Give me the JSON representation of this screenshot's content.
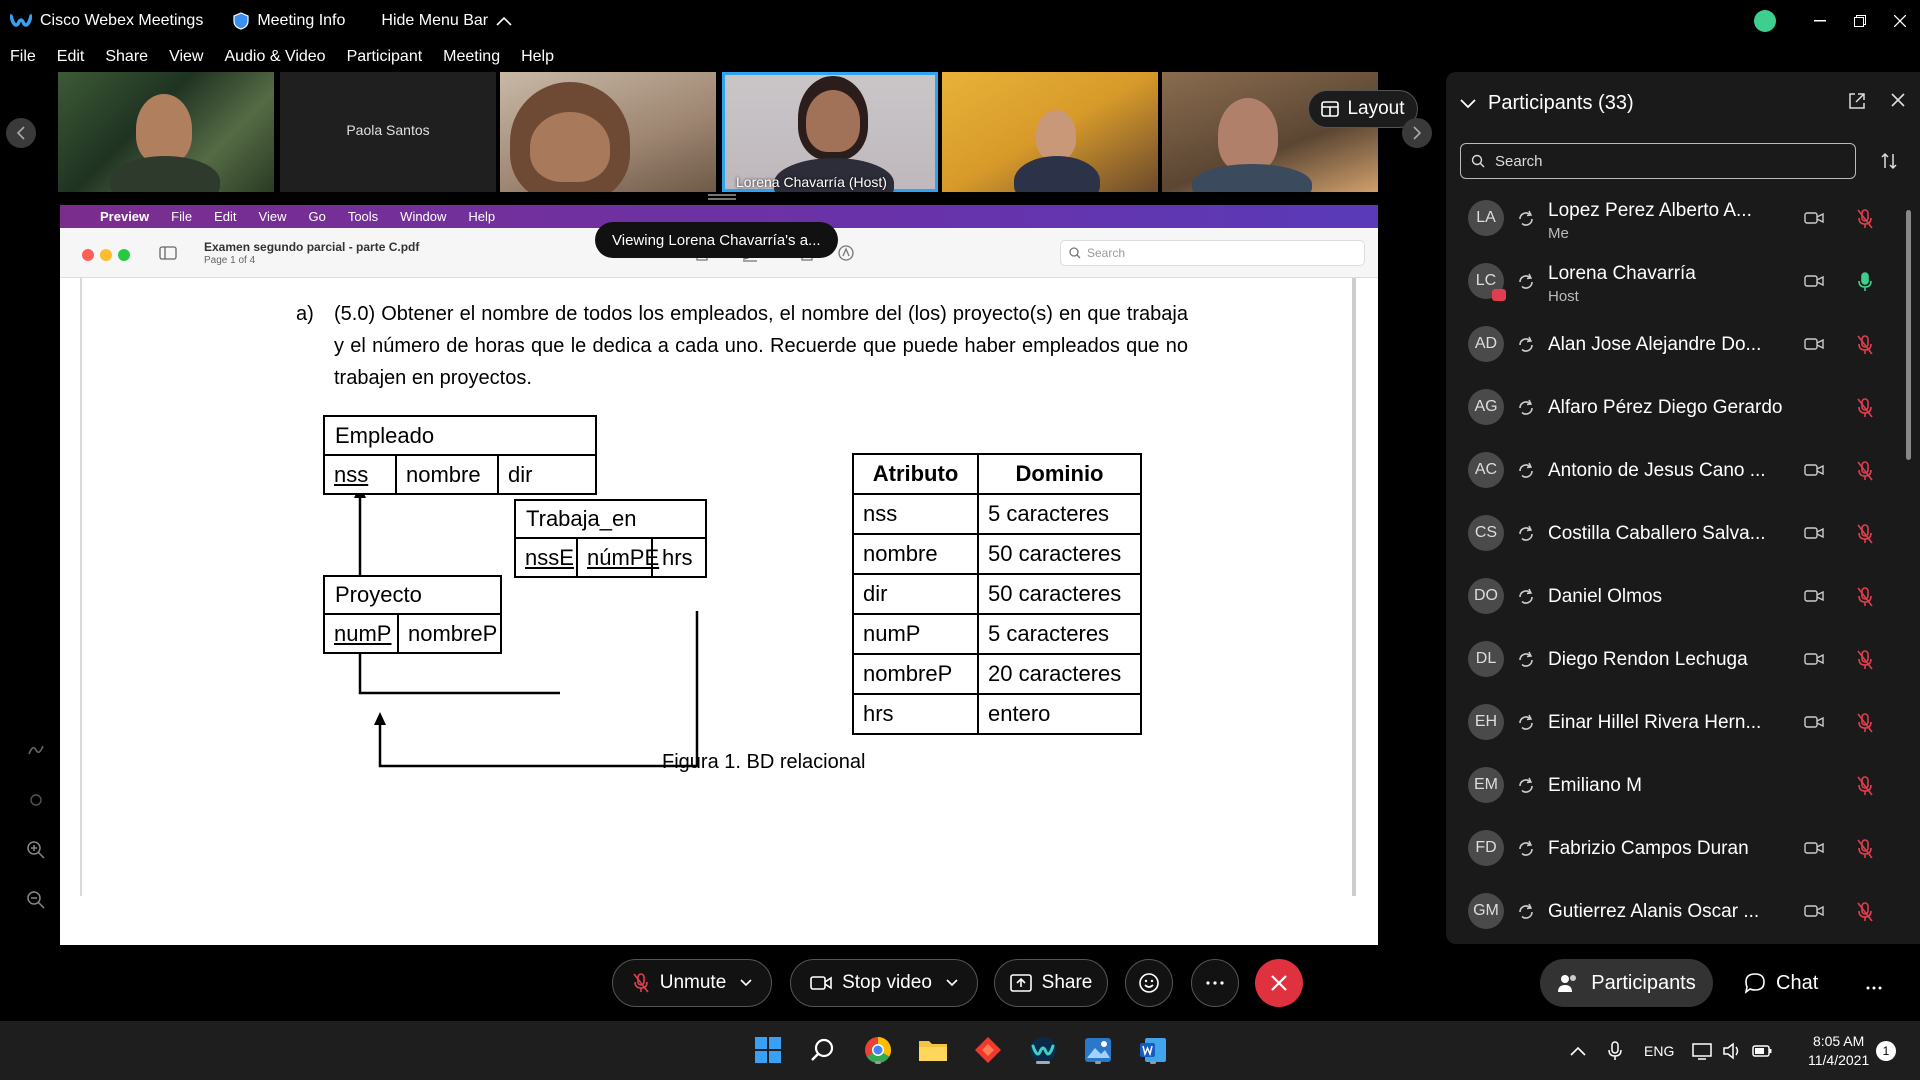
{
  "titlebar": {
    "app_title": "Cisco Webex Meetings",
    "meeting_info": "Meeting Info",
    "hide_menu_bar": "Hide Menu Bar"
  },
  "menu": [
    "File",
    "Edit",
    "Share",
    "View",
    "Audio & Video",
    "Participant",
    "Meeting",
    "Help"
  ],
  "video_strip": {
    "tiles": [
      {
        "name": ""
      },
      {
        "name": "Paola Santos"
      },
      {
        "name": ""
      },
      {
        "name": "Lorena Chavarría  (Host)"
      },
      {
        "name": ""
      },
      {
        "name": ""
      }
    ],
    "layout_label": "Layout"
  },
  "shared": {
    "mac_menu": [
      "Preview",
      "File",
      "Edit",
      "View",
      "Go",
      "Tools",
      "Window",
      "Help"
    ],
    "doc_title": "Examen segundo parcial - parte  C.pdf",
    "doc_sub": "Page 1 of 4",
    "search_placeholder": "Search",
    "viewing_tip": "Viewing Lorena Chavarría's a...",
    "question_num": "a)",
    "question": "(5.0) Obtener el nombre de todos los empleados, el nombre del (los) proyecto(s) en que trabaja y el número de horas que le dedica a cada uno. Recuerde que puede haber empleados que no trabajen en proyectos.",
    "empleado": {
      "title": "Empleado",
      "attrs": [
        "nss",
        "nombre",
        "dir"
      ]
    },
    "trabaja": {
      "title": "Trabaja_en",
      "attrs": [
        "nssE",
        "númPE",
        "hrs"
      ]
    },
    "proyecto": {
      "title": "Proyecto",
      "attrs": [
        "numP",
        "nombreP"
      ]
    },
    "domain_table": {
      "headers": [
        "Atributo",
        "Dominio"
      ],
      "rows": [
        [
          "nss",
          "5 caracteres"
        ],
        [
          "nombre",
          "50 caracteres"
        ],
        [
          "dir",
          "50 caracteres"
        ],
        [
          "numP",
          "5 caracteres"
        ],
        [
          "nombreP",
          "20 caracteres"
        ],
        [
          "hrs",
          "entero"
        ]
      ]
    },
    "caption": "Figura 1. BD relacional"
  },
  "panel": {
    "title": "Participants (33)",
    "search_placeholder": "Search",
    "participants": [
      {
        "initials": "LA",
        "name": "Lopez Perez Alberto A...",
        "role": "Me",
        "cam": true,
        "mic": "muted"
      },
      {
        "initials": "LC",
        "name": "Lorena Chavarría",
        "role": "Host",
        "cam": true,
        "mic": "active"
      },
      {
        "initials": "AD",
        "name": "Alan Jose Alejandre Do...",
        "role": "",
        "cam": true,
        "mic": "muted"
      },
      {
        "initials": "AG",
        "name": "Alfaro Pérez Diego Gerardo",
        "role": "",
        "cam": false,
        "mic": "muted"
      },
      {
        "initials": "AC",
        "name": "Antonio de Jesus Cano ...",
        "role": "",
        "cam": true,
        "mic": "muted"
      },
      {
        "initials": "CS",
        "name": "Costilla Caballero Salva...",
        "role": "",
        "cam": true,
        "mic": "muted"
      },
      {
        "initials": "DO",
        "name": "Daniel Olmos",
        "role": "",
        "cam": true,
        "mic": "muted"
      },
      {
        "initials": "DL",
        "name": "Diego Rendon Lechuga",
        "role": "",
        "cam": true,
        "mic": "muted"
      },
      {
        "initials": "EH",
        "name": "Einar Hillel Rivera Hern...",
        "role": "",
        "cam": true,
        "mic": "muted"
      },
      {
        "initials": "EM",
        "name": "Emiliano M",
        "role": "",
        "cam": false,
        "mic": "muted"
      },
      {
        "initials": "FD",
        "name": "Fabrizio Campos Duran",
        "role": "",
        "cam": true,
        "mic": "muted"
      },
      {
        "initials": "GM",
        "name": "Gutierrez Alanis Oscar ...",
        "role": "",
        "cam": true,
        "mic": "muted"
      }
    ]
  },
  "controls": {
    "unmute": "Unmute",
    "stop_video": "Stop video",
    "share": "Share",
    "participants": "Participants",
    "chat": "Chat"
  },
  "taskbar": {
    "lang": "ENG",
    "time": "8:05 AM",
    "date": "11/4/2021",
    "notifications": "1"
  },
  "colors": {
    "accent": "#2ea3f2",
    "end_call": "#e0313f",
    "mic_muted": "#e03e4e",
    "mic_active": "#3ecf8e"
  }
}
